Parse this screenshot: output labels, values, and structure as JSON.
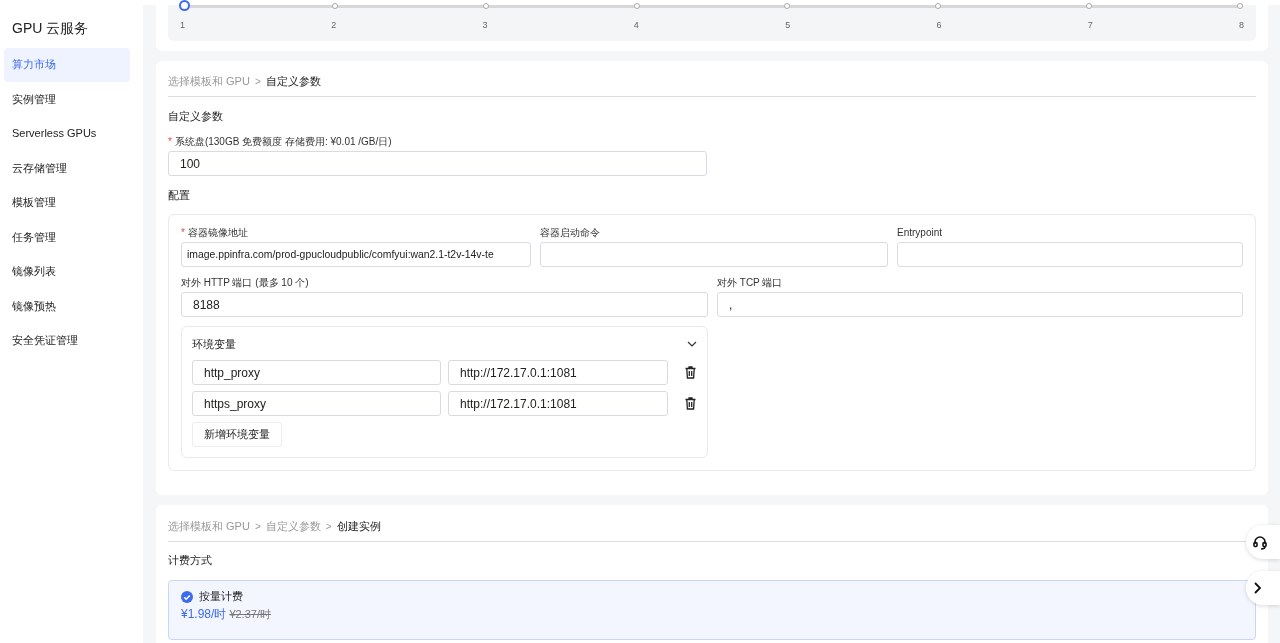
{
  "sidebar": {
    "title": "GPU 云服务",
    "items": [
      {
        "label": "算力市场",
        "selected": true
      },
      {
        "label": "实例管理",
        "selected": false
      },
      {
        "label": "Serverless GPUs",
        "selected": false
      },
      {
        "label": "云存储管理",
        "selected": false
      },
      {
        "label": "模板管理",
        "selected": false
      },
      {
        "label": "任务管理",
        "selected": false
      },
      {
        "label": "镜像列表",
        "selected": false
      },
      {
        "label": "镜像预热",
        "selected": false
      },
      {
        "label": "安全凭证管理",
        "selected": false
      }
    ]
  },
  "gpu_slider": {
    "level": 0,
    "ticks": [
      "1",
      "2",
      "3",
      "4",
      "5",
      "6",
      "7",
      "8"
    ]
  },
  "custom_params": {
    "breadcrumb": [
      {
        "label": "选择模板和 GPU",
        "selected": false
      },
      {
        "separator": ">",
        "label": "自定义参数",
        "selected": true
      }
    ],
    "section_title": "自定义参数",
    "system_disk": {
      "required_mark": "*",
      "label": "系统盘(130GB 免费额度 存储费用: ¥0.01 /GB/日)",
      "value": "100"
    },
    "config_title": "配置",
    "config_rows": [
      [
        {
          "required_mark": "*",
          "label": "容器镜像地址",
          "value": "image.ppinfra.com/prod-gpucloudpublic/comfyui:wan2.1-t2v-14v-te"
        },
        {
          "label": "容器启动命令"
        },
        {
          "label": "Entrypoint"
        }
      ],
      [
        {
          "label": "对外 HTTP 端口 (最多 10 个)",
          "value": "8188"
        },
        {
          "label": "对外 TCP 端口",
          "value": ","
        }
      ]
    ],
    "env": {
      "title": "环境变量",
      "expanded": true,
      "rows": [
        {
          "key": "http_proxy",
          "value": "http://172.17.0.1:1081"
        },
        {
          "key": "https_proxy",
          "value": "http://172.17.0.1:1081"
        }
      ],
      "add_button": "新增环境变量"
    }
  },
  "create_instance": {
    "breadcrumb": [
      {
        "label": "选择模板和 GPU",
        "selected": false
      },
      {
        "separator": ">",
        "label": "自定义参数",
        "selected": false
      },
      {
        "separator": ">",
        "label": "创建实例",
        "selected": true
      }
    ],
    "billing_title": "计费方式",
    "billing_options": [
      {
        "label": "按量计费",
        "selected": true,
        "price": "¥1.98/时",
        "original_price": "¥2.37/时"
      }
    ]
  }
}
